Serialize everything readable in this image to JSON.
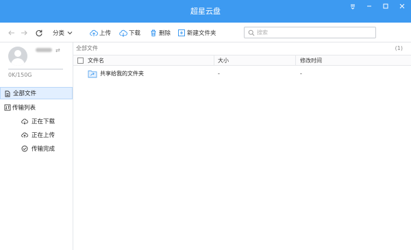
{
  "app": {
    "title": "超星云盘"
  },
  "window_controls": [
    "menu-icon",
    "minimize-icon",
    "maximize-icon",
    "close-icon"
  ],
  "toolbar": {
    "back_icon": "arrow-left-icon",
    "forward_icon": "arrow-right-icon",
    "refresh_icon": "refresh-icon",
    "sort_label": "分类",
    "upload_label": "上传",
    "download_label": "下载",
    "delete_label": "删除",
    "new_folder_label": "新建文件夹",
    "search_placeholder": "搜索"
  },
  "user": {
    "quota": "0K/150G",
    "quota_used_fraction": 0
  },
  "sidebar": {
    "items": [
      {
        "label": "全部文件",
        "icon": "document-icon",
        "selected": true
      },
      {
        "label": "传输列表",
        "icon": "transfer-list-icon"
      },
      {
        "label": "正在下载",
        "icon": "cloud-download-icon"
      },
      {
        "label": "正在上传",
        "icon": "cloud-upload-icon"
      },
      {
        "label": "传输完成",
        "icon": "check-circle-icon"
      }
    ]
  },
  "main": {
    "breadcrumb": "全部文件",
    "count": "(1)",
    "columns": [
      "文件名",
      "大小",
      "修改时间"
    ],
    "rows": [
      {
        "name": "共享给我的文件夹",
        "size": "-",
        "modified": "-",
        "icon": "shared-folder-icon"
      }
    ]
  },
  "colors": {
    "accent": "#3d9af1",
    "selected_bg": "#e2efff",
    "border": "#e3e6ea"
  }
}
